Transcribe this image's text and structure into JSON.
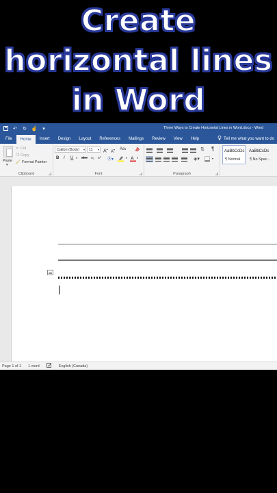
{
  "overlay": {
    "lines": [
      "Create",
      "horizontal lines",
      "in Word"
    ]
  },
  "window": {
    "title": "Three Ways to Create Horizontal Lines in Word.docx - Word"
  },
  "tabs": [
    {
      "label": "File"
    },
    {
      "label": "Home"
    },
    {
      "label": "Insert"
    },
    {
      "label": "Design"
    },
    {
      "label": "Layout"
    },
    {
      "label": "References"
    },
    {
      "label": "Mailings"
    },
    {
      "label": "Review"
    },
    {
      "label": "View"
    },
    {
      "label": "Help"
    }
  ],
  "active_tab": "Home",
  "tell_me": "Tell me what you want to do",
  "clipboard": {
    "paste_label": "Paste",
    "cut_label": "Cut",
    "copy_label": "Copy",
    "format_painter_label": "Format Painter",
    "group_label": "Clipboard"
  },
  "font": {
    "font_name": "Calibri (Body)",
    "font_size": "11",
    "grow": "A",
    "shrink": "A",
    "case": "Aa",
    "bold": "B",
    "italic": "I",
    "underline": "U",
    "strike": "abc",
    "subscript": "x₂",
    "superscript": "x²",
    "group_label": "Font"
  },
  "paragraph": {
    "group_label": "Paragraph",
    "pilcrow": "¶"
  },
  "styles": [
    {
      "sample": "AaBbCcDc",
      "name": "¶ Normal"
    },
    {
      "sample": "AaBbCcDc",
      "name": "¶ No Spac..."
    }
  ],
  "status": {
    "page": "Page 1 of 1",
    "words": "1 word",
    "language": "English (Canada)"
  },
  "colors": {
    "word_blue": "#2b579a",
    "ribbon_bg": "#f3f3f3",
    "overlay_text": "#ffffff",
    "overlay_outline": "#2a3a9a"
  }
}
